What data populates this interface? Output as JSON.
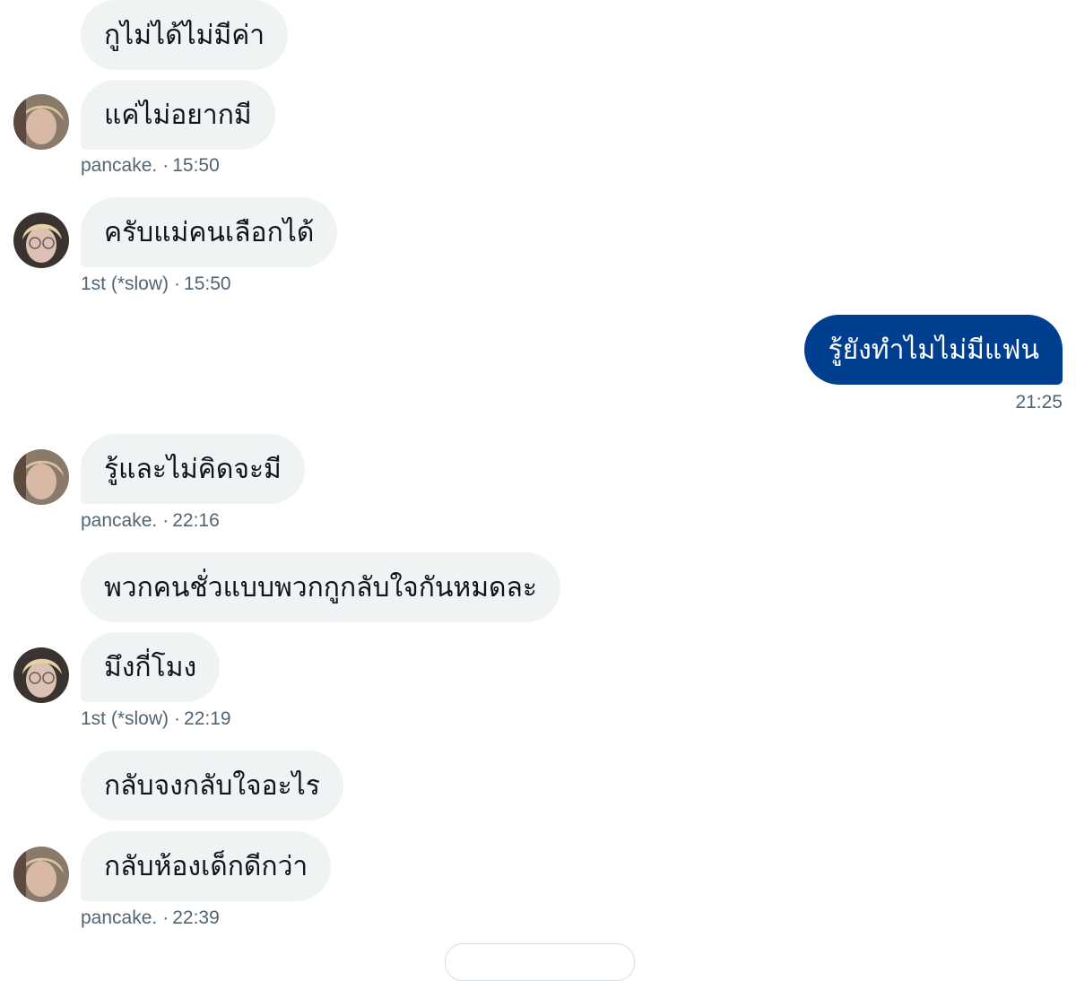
{
  "conversation": {
    "messages": [
      {
        "id": "m1",
        "direction": "incoming",
        "text": "กูไม่ได้ไม่มีค่า"
      },
      {
        "id": "m2",
        "direction": "incoming",
        "text": "แค่ไม่อยากมี",
        "sender": "pancake.",
        "time": "15:50"
      },
      {
        "id": "m3",
        "direction": "incoming",
        "text": "ครับแม่คนเลือกได้",
        "sender": "1st (*slow)",
        "time": "15:50"
      },
      {
        "id": "m4",
        "direction": "outgoing",
        "text": "รู้ยังทำไมไม่มีแฟน",
        "time": "21:25"
      },
      {
        "id": "m5",
        "direction": "incoming",
        "text": "รู้และไม่คิดจะมี",
        "sender": "pancake.",
        "time": "22:16"
      },
      {
        "id": "m6",
        "direction": "incoming",
        "text": "พวกคนชั่วแบบพวกกูกลับใจกันหมดละ"
      },
      {
        "id": "m7",
        "direction": "incoming",
        "text": "มึงกี่โมง",
        "sender": "1st (*slow)",
        "time": "22:19"
      },
      {
        "id": "m8",
        "direction": "incoming",
        "text": "กลับจงกลับใจอะไร"
      },
      {
        "id": "m9",
        "direction": "incoming",
        "text": "กลับห้องเด็กดีกว่า",
        "sender": "pancake.",
        "time": "22:39"
      }
    ],
    "separator": "·"
  },
  "colors": {
    "incoming_bubble": "#eff3f4",
    "outgoing_bubble": "#003f8f",
    "meta_text": "#536471"
  }
}
